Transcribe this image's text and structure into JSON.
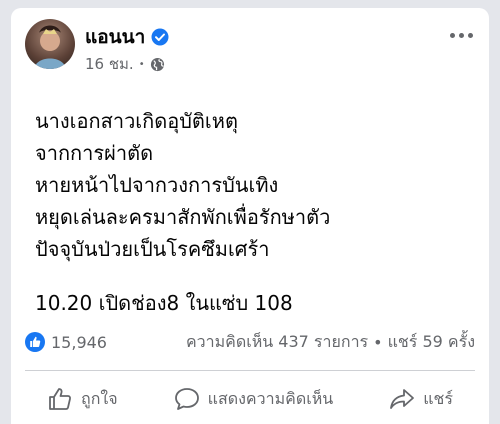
{
  "post": {
    "author": "แอนนา",
    "time": "16 ชม.",
    "separator": "•",
    "lines": [
      "นางเอกสาวเกิดอุบัติเหตุ",
      "จากการผ่าตัด",
      "หายหน้าไปจากวงการบันเทิง",
      "หยุดเล่นละครมาสักพักเพื่อรักษาตัว",
      "ปัจจุบันป่วยเป็นโรคซึมเศร้า"
    ],
    "highlight": "10.20 เปิดช่อง8 ในแซ่บ 108"
  },
  "stats": {
    "likes": "15,946",
    "comments": "ความคิดเห็น 437 รายการ",
    "dot": "•",
    "shares": "แชร์ 59 ครั้ง"
  },
  "actions": {
    "like": "ถูกใจ",
    "comment": "แสดงความคิดเห็น",
    "share": "แชร์"
  },
  "colors": {
    "verified": "#1877f2",
    "muted": "#65676b"
  },
  "icons": {
    "verified": "verified-badge-icon",
    "audience": "globe-icon",
    "more": "more-options-icon",
    "like_badge": "thumbs-up-badge-icon",
    "like": "thumbs-up-icon",
    "comment": "comment-icon",
    "share": "share-arrow-icon"
  }
}
